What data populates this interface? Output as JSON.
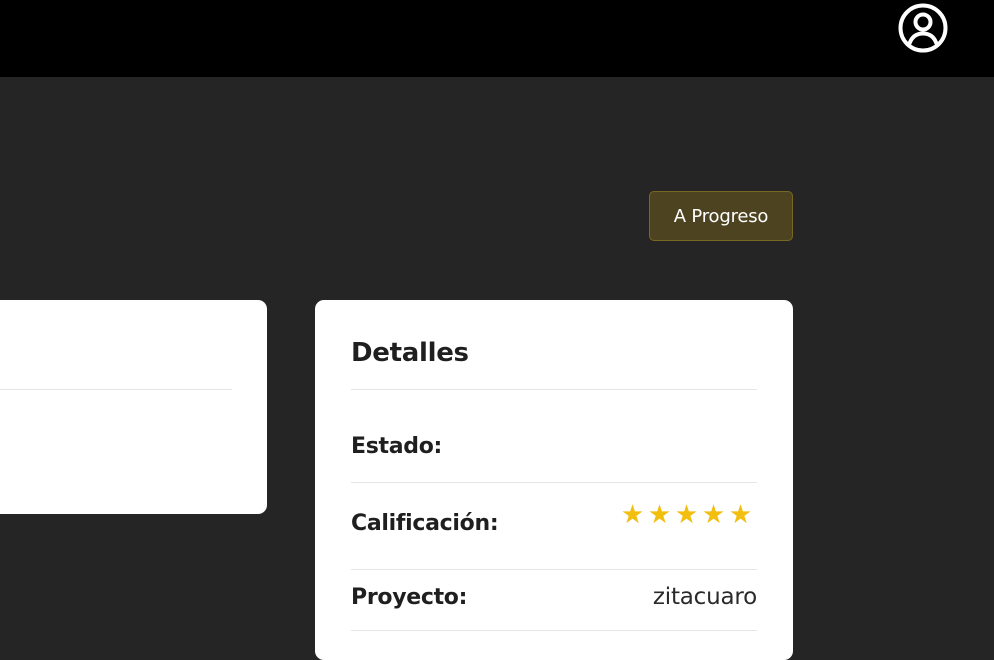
{
  "header": {
    "user_icon": "user-circle-icon"
  },
  "status_button": {
    "label": "A Progreso",
    "background": "#4e4320",
    "border": "#7a6722"
  },
  "details": {
    "title": "Detalles",
    "rows": {
      "estado": {
        "label": "Estado:",
        "value": ""
      },
      "calificacion": {
        "label": "Calificación:",
        "rating": 5,
        "max": 5,
        "star_glyph": "★",
        "star_color": "#f2be10"
      },
      "proyecto": {
        "label": "Proyecto:",
        "value": "zitacuaro"
      }
    }
  }
}
